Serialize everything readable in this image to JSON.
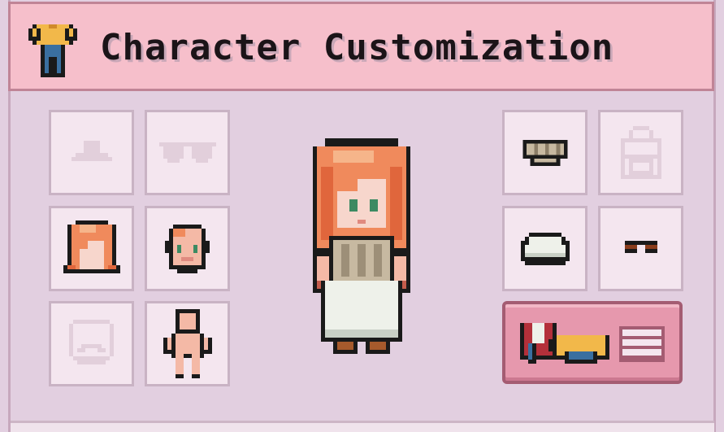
{
  "header": {
    "title": "Character Customization",
    "icon": "shirt-pants-icon"
  },
  "left_slots": [
    {
      "name": "hat",
      "icon": "hat-icon",
      "equipped": false
    },
    {
      "name": "glasses",
      "icon": "glasses-icon",
      "equipped": false
    },
    {
      "name": "hair",
      "icon": "hair-icon",
      "equipped": true
    },
    {
      "name": "face",
      "icon": "face-icon",
      "equipped": true
    },
    {
      "name": "beard",
      "icon": "beard-icon",
      "equipped": false
    },
    {
      "name": "body",
      "icon": "body-icon",
      "equipped": true
    }
  ],
  "right_slots": [
    {
      "name": "top",
      "icon": "top-icon",
      "equipped": true
    },
    {
      "name": "backpack",
      "icon": "backpack-icon",
      "equipped": false
    },
    {
      "name": "dress",
      "icon": "dress-icon",
      "equipped": true
    },
    {
      "name": "shoes",
      "icon": "shoes-icon",
      "equipped": true
    }
  ],
  "wardrobe_button": {
    "icon": "wardrobe-icon",
    "menu_icon": "list-icon"
  },
  "colors": {
    "header_bg": "#f6bfcb",
    "panel_bg": "#e2cfe0",
    "slot_bg": "#f4e6ef",
    "accent": "#e698ad",
    "hair": "#f08a5c"
  }
}
